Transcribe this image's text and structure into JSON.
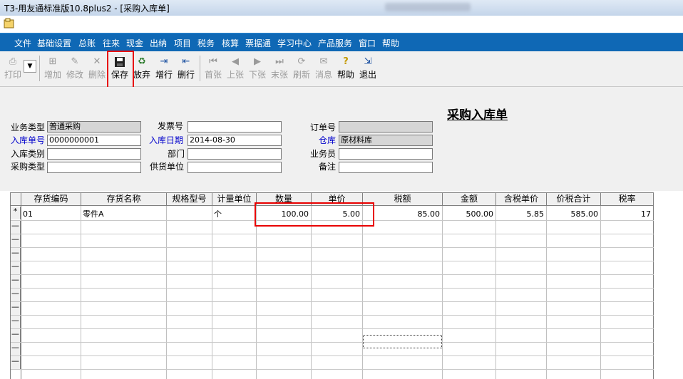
{
  "window": {
    "title": "T3-用友通标准版10.8plus2 - [采购入库单]"
  },
  "menu": [
    "文件",
    "基础设置",
    "总账",
    "往来",
    "现金",
    "出纳",
    "项目",
    "税务",
    "核算",
    "票据通",
    "学习中心",
    "产品服务",
    "窗口",
    "帮助"
  ],
  "toolbar": {
    "print": "打印",
    "add": "增加",
    "modify": "修改",
    "delete": "删除",
    "save": "保存",
    "discard": "放弃",
    "add_row": "增行",
    "delete_row": "删行",
    "first": "首张",
    "prev": "上张",
    "next": "下张",
    "last": "末张",
    "refresh": "刷新",
    "message": "消息",
    "help": "帮助",
    "exit": "退出"
  },
  "form": {
    "doc_title": "采购入库单",
    "labels": {
      "business_type": "业务类型",
      "invoice_no": "发票号",
      "order_no": "订单号",
      "receipt_no": "入库单号",
      "receipt_date": "入库日期",
      "warehouse": "仓库",
      "receipt_category": "入库类别",
      "department": "部门",
      "salesperson": "业务员",
      "purchase_type": "采购类型",
      "supplier": "供货单位",
      "remark": "备注"
    },
    "values": {
      "business_type": "普通采购",
      "invoice_no": "",
      "order_no": "",
      "receipt_no": "0000000001",
      "receipt_date": "2014-08-30",
      "warehouse": "原材料库",
      "receipt_category": "",
      "department": "",
      "salesperson": "",
      "purchase_type": "",
      "supplier": "",
      "remark": ""
    }
  },
  "grid": {
    "columns": [
      "存货编码",
      "存货名称",
      "规格型号",
      "计量单位",
      "数量",
      "单价",
      "税额",
      "金额",
      "含税单价",
      "价税合计",
      "税率"
    ],
    "row": {
      "marker": "*",
      "code": "01",
      "name": "零件A",
      "spec": "",
      "unit": "个",
      "qty": "100.00",
      "price": "5.00",
      "tax": "85.00",
      "amount": "500.00",
      "tax_price": "5.85",
      "total": "585.00",
      "rate": "17"
    }
  },
  "colors": {
    "menubar": "#0f68b5",
    "highlight": "#e80000",
    "field_label_blue": "#0000cc"
  }
}
